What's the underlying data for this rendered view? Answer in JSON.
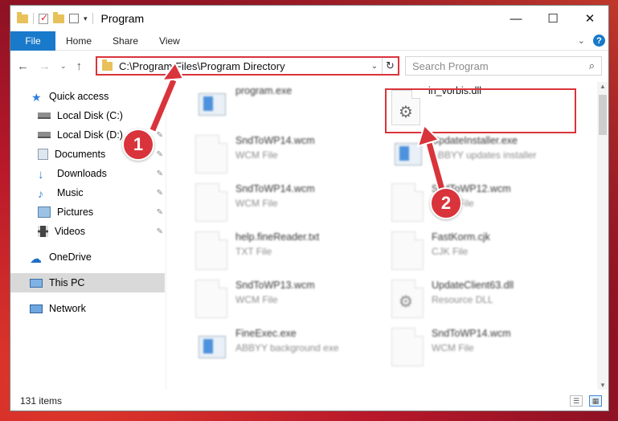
{
  "window": {
    "title": "Program"
  },
  "ribbon": {
    "tabs": [
      "File",
      "Home",
      "Share",
      "View"
    ],
    "help": "?"
  },
  "address": {
    "path": "C:\\Program Files\\Program Directory"
  },
  "search": {
    "placeholder": "Search Program"
  },
  "sidebar": {
    "items": [
      {
        "label": "Quick access",
        "icon": "star-icon",
        "pinned": false
      },
      {
        "label": "Local Disk (C:)",
        "icon": "drive-icon",
        "pinned": true
      },
      {
        "label": "Local Disk (D:)",
        "icon": "drive-icon",
        "pinned": true
      },
      {
        "label": "Documents",
        "icon": "documents-icon",
        "pinned": true
      },
      {
        "label": "Downloads",
        "icon": "download-icon",
        "pinned": true
      },
      {
        "label": "Music",
        "icon": "music-icon",
        "pinned": true
      },
      {
        "label": "Pictures",
        "icon": "pictures-icon",
        "pinned": true
      },
      {
        "label": "Videos",
        "icon": "videos-icon",
        "pinned": true
      },
      {
        "label": "OneDrive",
        "icon": "cloud-icon",
        "pinned": false
      },
      {
        "label": "This PC",
        "icon": "computer-icon",
        "pinned": false
      },
      {
        "label": "Network",
        "icon": "network-icon",
        "pinned": false
      }
    ]
  },
  "files": [
    {
      "name": "program.exe",
      "type": "",
      "icon": "installer-icon"
    },
    {
      "name": "in_vorbis.dll",
      "type": "",
      "icon": "dll-gear-icon"
    },
    {
      "name": "SndToWP14.wcm",
      "type": "WCM File",
      "icon": "blank-file-icon"
    },
    {
      "name": "UpdateInstaller.exe",
      "type": "ABBYY updates installer",
      "icon": "app-icon"
    },
    {
      "name": "SndToWP14.wcm",
      "type": "WCM File",
      "icon": "blank-file-icon"
    },
    {
      "name": "SndToWP12.wcm",
      "type": "WCM File",
      "icon": "blank-file-icon"
    },
    {
      "name": "help.fineReader.txt",
      "type": "TXT File",
      "icon": "blank-file-icon"
    },
    {
      "name": "FastKorm.cjk",
      "type": "CJK File",
      "icon": "blank-file-icon"
    },
    {
      "name": "SndToWP13.wcm",
      "type": "WCM File",
      "icon": "blank-file-icon"
    },
    {
      "name": "UpdateClient63.dll",
      "type": "Resource DLL",
      "icon": "dll-gear-icon"
    },
    {
      "name": "FineExec.exe",
      "type": "ABBYY background exe",
      "icon": "app-icon"
    },
    {
      "name": "SndToWP14.wcm",
      "type": "WCM File",
      "icon": "blank-file-icon"
    }
  ],
  "status": {
    "count": "131 items"
  },
  "callouts": [
    "1",
    "2"
  ],
  "colors": {
    "accent": "#1979ca",
    "highlight": "#d9343b"
  }
}
